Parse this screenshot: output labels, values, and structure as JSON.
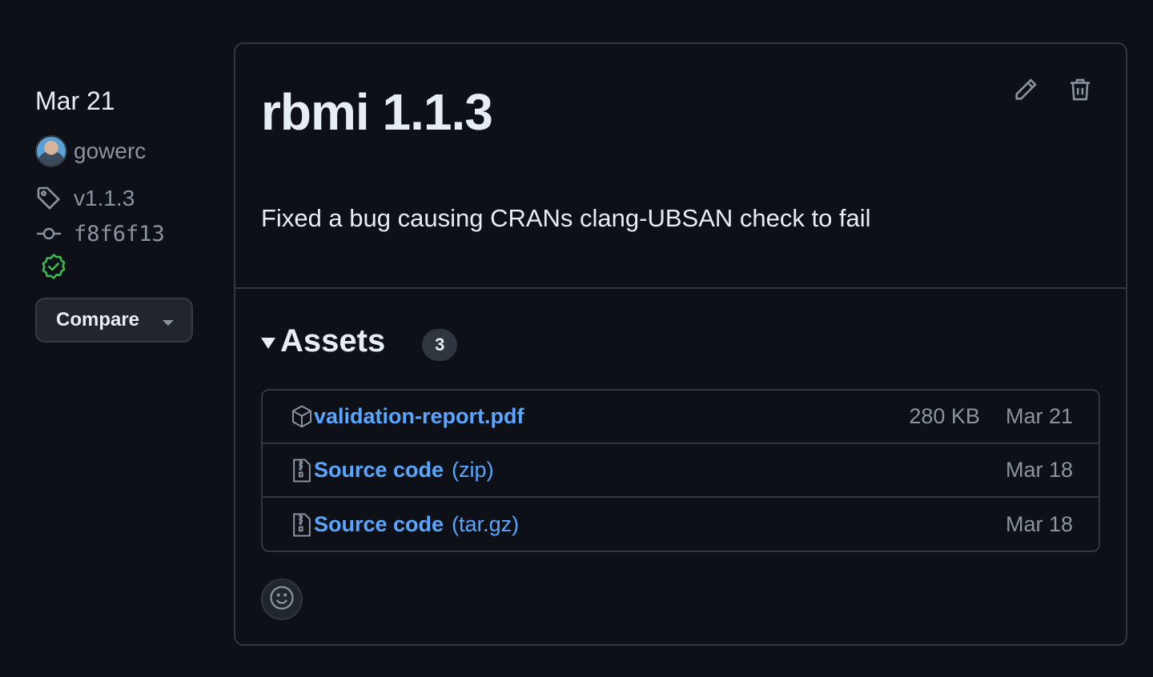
{
  "sidebar": {
    "date": "Mar 21",
    "author": "gowerc",
    "tag": "v1.1.3",
    "commit": "f8f6f13",
    "compare_label": "Compare"
  },
  "release": {
    "title": "rbmi 1.1.3",
    "description": "Fixed a bug causing CRANs clang-UBSAN check to fail"
  },
  "assets": {
    "title": "Assets",
    "count": "3",
    "items": [
      {
        "name": "validation-report.pdf",
        "suffix": "",
        "size": "280 KB",
        "date": "Mar 21",
        "icon": "package-icon"
      },
      {
        "name": "Source code",
        "suffix": "(zip)",
        "size": "",
        "date": "Mar 18",
        "icon": "file-zip-icon"
      },
      {
        "name": "Source code",
        "suffix": "(tar.gz)",
        "size": "",
        "date": "Mar 18",
        "icon": "file-zip-icon"
      }
    ]
  },
  "colors": {
    "background": "#0d1117",
    "link": "#58a6ff",
    "muted": "#8b949e",
    "border": "#30363d",
    "verified": "#3fb950"
  }
}
